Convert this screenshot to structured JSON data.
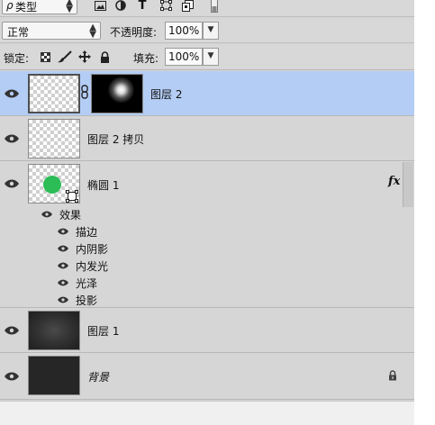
{
  "filter": {
    "kind_label": "类型",
    "search_glyph": "ρ"
  },
  "blend": {
    "mode": "正常",
    "opacity_label": "不透明度:",
    "opacity_value": "100%"
  },
  "lock": {
    "label": "锁定:",
    "fill_label": "填充:",
    "fill_value": "100%"
  },
  "layers": [
    {
      "name": "图层 2",
      "selected": true
    },
    {
      "name": "图层 2 拷贝",
      "selected": false
    },
    {
      "name": "椭圆 1",
      "selected": false,
      "fx": "fx"
    },
    {
      "name": "图层 1",
      "selected": false
    },
    {
      "name": "背景",
      "selected": false
    }
  ],
  "effects": {
    "title": "效果",
    "items": [
      "描边",
      "内阴影",
      "内发光",
      "光泽",
      "投影"
    ]
  },
  "colors": {
    "selected_row": "#b4cdf5",
    "shape_green": "#2dbd57",
    "panel_bg": "#d6d6d6"
  }
}
